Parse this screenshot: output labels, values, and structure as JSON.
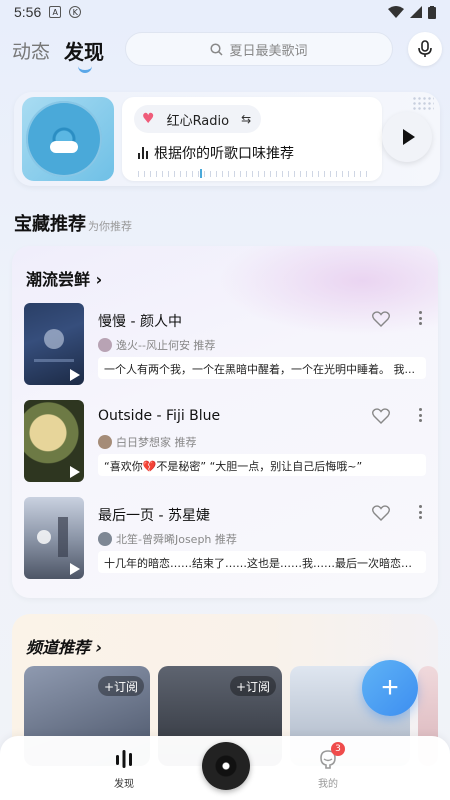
{
  "status_bar": {
    "time": "5:56",
    "icon_a": "A",
    "icon_k": "K"
  },
  "header": {
    "tabs": [
      {
        "label": "动态"
      },
      {
        "label": "发现"
      }
    ],
    "search_placeholder": "夏日最美歌词"
  },
  "radio": {
    "chip_label": "红心Radio",
    "subtitle": "根据你的听歌口味推荐"
  },
  "section": {
    "title": "宝藏推荐",
    "subtitle": "为你推荐"
  },
  "trend": {
    "title": "潮流尝鲜",
    "songs": [
      {
        "name": "慢慢 - 颜人中",
        "recommender": "逸火--风止何安 推荐",
        "quote": "一个人有两个我，一个在黑暗中醒着，一个在光明中睡着。 我..."
      },
      {
        "name": "Outside - Fiji Blue",
        "recommender": "白日梦想家 推荐",
        "quote": "“喜欢你💔不是秘密” “大胆一点，别让自己后悔哦~”"
      },
      {
        "name": "最后一页 - 苏星婕",
        "recommender": "北笙-曾舜晞Joseph 推荐",
        "quote": "十几年的暗恋……结束了……这也是……我……最后一次暗恋了……"
      }
    ]
  },
  "channels": {
    "title": "频道推荐",
    "subscribe_label": "+订阅"
  },
  "bottom_nav": {
    "discover_label": "发现",
    "mine_label": "我的",
    "mine_badge": "3"
  },
  "colors": {
    "accent": "#3d8ef0",
    "heart": "#ef5c7a",
    "badge": "#ef4c4c"
  }
}
